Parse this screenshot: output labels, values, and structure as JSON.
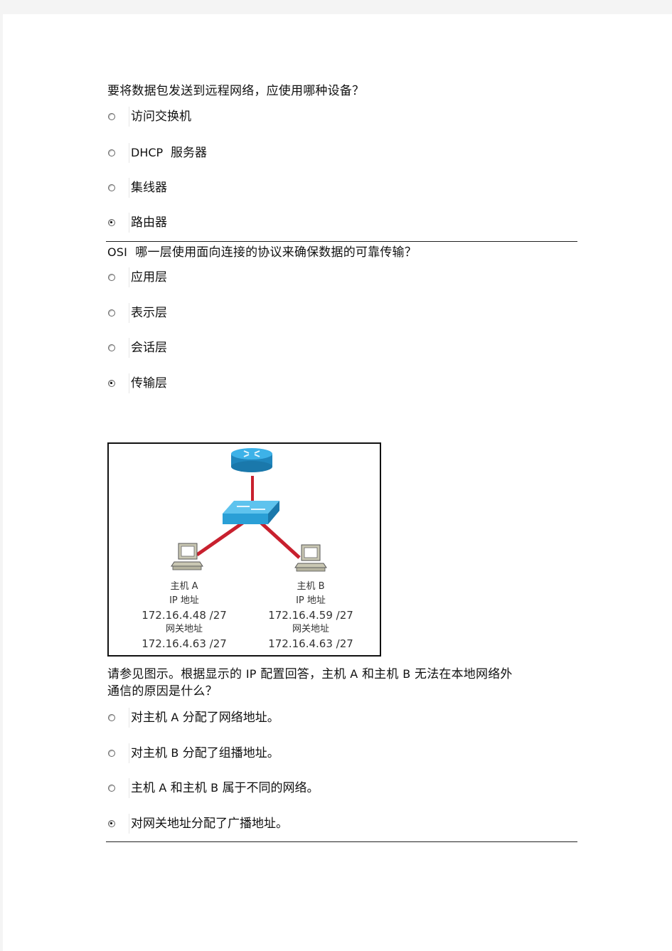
{
  "questions": [
    {
      "text": "要将数据包发送到远程网络，应使用哪种设备？",
      "options": [
        {
          "label": "访问交换机",
          "checked": false
        },
        {
          "label_prefix": "DHCP",
          "label": "服务器",
          "checked": false
        },
        {
          "label": "集线器",
          "checked": false
        },
        {
          "label": "路由器",
          "checked": true
        }
      ]
    },
    {
      "text_prefix": "OSI",
      "text": "哪一层使用面向连接的协议来确保数据的可靠传输？",
      "options": [
        {
          "label": "应用层",
          "checked": false
        },
        {
          "label": "表示层",
          "checked": false
        },
        {
          "label": "会话层",
          "checked": false
        },
        {
          "label": "传输层",
          "checked": true
        }
      ]
    },
    {
      "exhibit": {
        "devices": [
          "router",
          "switch",
          "host-a-pc",
          "host-b-pc"
        ],
        "host_a": {
          "name": "主机 A",
          "ip_label": "IP 地址",
          "ip": "172.16.4.48 /27",
          "gw_label": "网关地址",
          "gw": "172.16.4.63 /27"
        },
        "host_b": {
          "name": "主机 B",
          "ip_label": "IP 地址",
          "ip": "172.16.4.59 /27",
          "gw_label": "网关地址",
          "gw": "172.16.4.63 /27"
        },
        "colors": {
          "device": "#2a9fd6",
          "link": "#c8202e",
          "pc": "#c9c7b3"
        }
      },
      "text_line1_a": "请参见图示。根据显示的",
      "text_line1_b": "IP",
      "text_line1_c": "配置回答，主机",
      "text_line1_d": "A",
      "text_line1_e": "和主机",
      "text_line1_f": "B",
      "text_line1_g": "无法在本地网络外",
      "text_line2": "通信的原因是什么？",
      "options": [
        {
          "p1": "对主机",
          "p2": "A",
          "p3": "分配了网络地址。",
          "checked": false
        },
        {
          "p1": "对主机",
          "p2": "B",
          "p3": "分配了组播地址。",
          "checked": false
        },
        {
          "p1": "主机",
          "p2": "A",
          "p3": "和主机",
          "p4": "B",
          "p5": "属于不同的网络。",
          "checked": false
        },
        {
          "p1": "对网关地址分配了广播地址。",
          "checked": true
        }
      ]
    }
  ]
}
